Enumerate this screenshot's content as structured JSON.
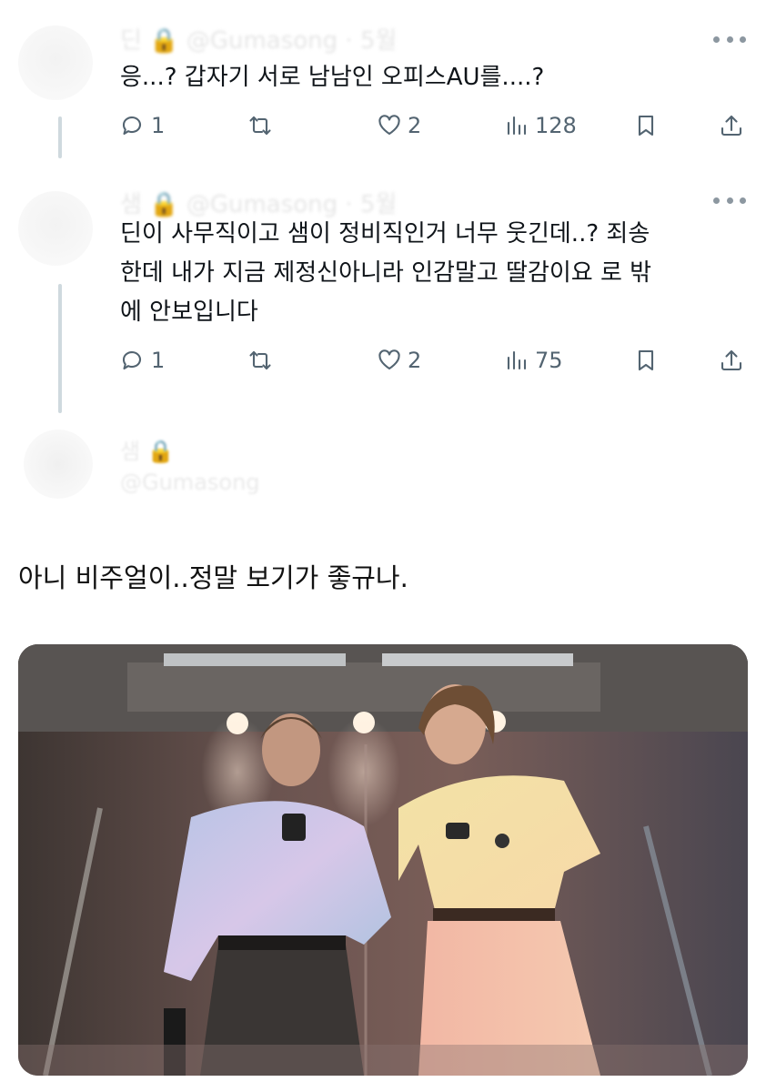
{
  "tweets": [
    {
      "header": "딘 🔒 @Gumasong · 5월",
      "text": "응...? 갑자기 서로 남남인 오피스AU를....?",
      "replies": "1",
      "likes": "2",
      "views": "128"
    },
    {
      "header": "샘 🔒 @Gumasong · 5월",
      "text_lines": [
        "딘이 사무직이고 샘이 정비직인거 너무 웃긴데..? 죄송",
        "한데 내가 지금 제정신아니라 인감말고 딸감이요 로 밖",
        "에 안보입니다"
      ],
      "replies": "1",
      "likes": "2",
      "views": "75"
    }
  ],
  "faded_tweet": {
    "name": "샘 🔒",
    "handle": "@Gumasong"
  },
  "caption": "아니 비주얼이..정말 보기가 좋규나.",
  "colors": {
    "text": "#0f1419",
    "muted": "#536471",
    "thread_line": "#cfd9de"
  },
  "icons": [
    "reply-icon",
    "retweet-icon",
    "like-icon",
    "views-icon",
    "bookmark-icon",
    "share-icon",
    "more-icon"
  ]
}
